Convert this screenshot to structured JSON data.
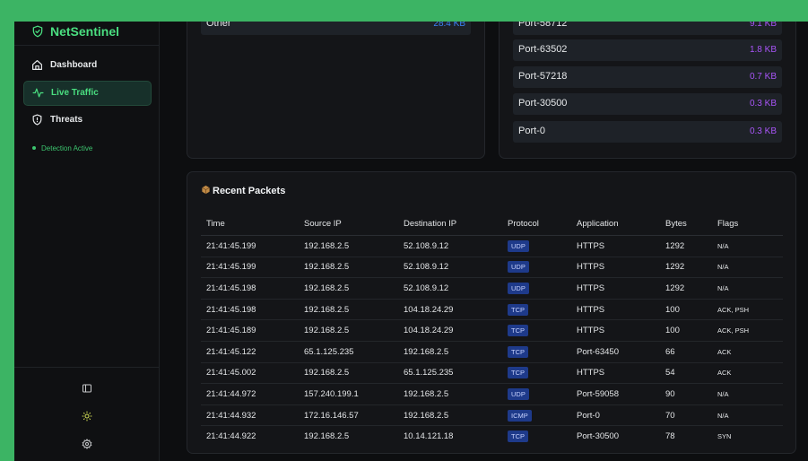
{
  "brand": {
    "name": "NetSentinel",
    "accent": "#4ade80"
  },
  "nav": [
    {
      "label": "Dashboard",
      "icon": "home-icon",
      "active": false
    },
    {
      "label": "Live Traffic",
      "icon": "activity-icon",
      "active": true
    },
    {
      "label": "Threats",
      "icon": "alert-icon",
      "active": false
    }
  ],
  "status": {
    "label": "Detection Active",
    "color": "#3cc46e"
  },
  "footer_icons": [
    "panel-toggle-icon",
    "sun-icon",
    "gear-icon"
  ],
  "left_panel": {
    "rows": [
      {
        "label": "Other",
        "value": "28.4 KB",
        "value_color": "#3b82f6"
      }
    ]
  },
  "right_panel": {
    "rows": [
      {
        "label": "Port-58712",
        "value": "9.1 KB"
      },
      {
        "label": "Port-63502",
        "value": "1.8 KB"
      },
      {
        "label": "Port-57218",
        "value": "0.7 KB"
      },
      {
        "label": "Port-30500",
        "value": "0.3 KB"
      },
      {
        "label": "Port-0",
        "value": "0.3 KB"
      }
    ],
    "value_color": "#a855f7"
  },
  "packets": {
    "title": "Recent Packets",
    "title_icon": "package-icon",
    "columns": [
      "Time",
      "Source IP",
      "Destination IP",
      "Protocol",
      "Application",
      "Bytes",
      "Flags"
    ],
    "rows": [
      [
        "21:41:45.199",
        "192.168.2.5",
        "52.108.9.12",
        "UDP",
        "HTTPS",
        "1292",
        "N/A"
      ],
      [
        "21:41:45.199",
        "192.168.2.5",
        "52.108.9.12",
        "UDP",
        "HTTPS",
        "1292",
        "N/A"
      ],
      [
        "21:41:45.198",
        "192.168.2.5",
        "52.108.9.12",
        "UDP",
        "HTTPS",
        "1292",
        "N/A"
      ],
      [
        "21:41:45.198",
        "192.168.2.5",
        "104.18.24.29",
        "TCP",
        "HTTPS",
        "100",
        "ACK, PSH"
      ],
      [
        "21:41:45.189",
        "192.168.2.5",
        "104.18.24.29",
        "TCP",
        "HTTPS",
        "100",
        "ACK, PSH"
      ],
      [
        "21:41:45.122",
        "65.1.125.235",
        "192.168.2.5",
        "TCP",
        "Port-63450",
        "66",
        "ACK"
      ],
      [
        "21:41:45.002",
        "192.168.2.5",
        "65.1.125.235",
        "TCP",
        "HTTPS",
        "54",
        "ACK"
      ],
      [
        "21:41:44.972",
        "157.240.199.1",
        "192.168.2.5",
        "UDP",
        "Port-59058",
        "90",
        "N/A"
      ],
      [
        "21:41:44.932",
        "172.16.146.57",
        "192.168.2.5",
        "ICMP",
        "Port-0",
        "70",
        "N/A"
      ],
      [
        "21:41:44.922",
        "192.168.2.5",
        "10.14.121.18",
        "TCP",
        "Port-30500",
        "78",
        "SYN"
      ]
    ]
  }
}
